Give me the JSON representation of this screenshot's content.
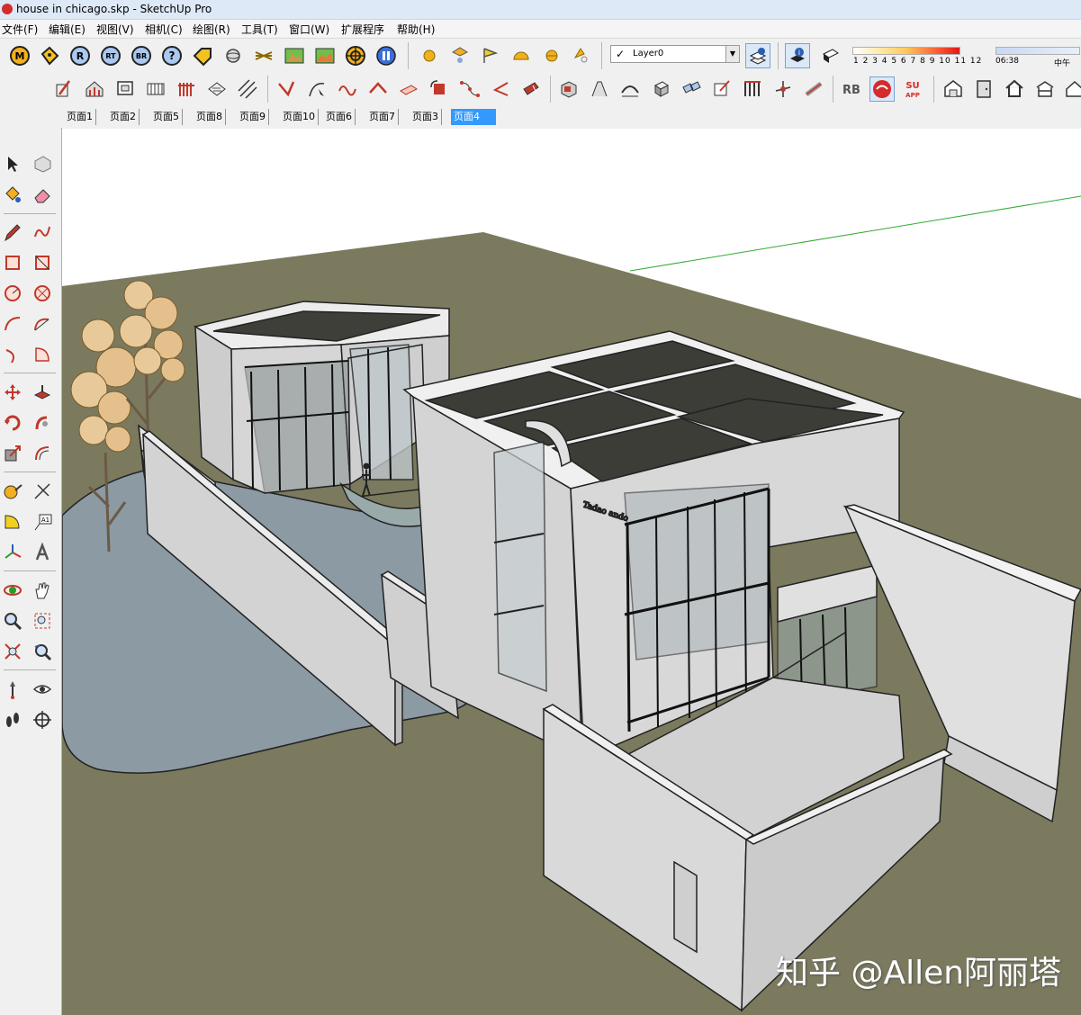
{
  "window": {
    "title": "house in chicago.skp - SketchUp Pro"
  },
  "menu": [
    {
      "id": "file",
      "label": "文件(F)"
    },
    {
      "id": "edit",
      "label": "编辑(E)"
    },
    {
      "id": "view",
      "label": "视图(V)"
    },
    {
      "id": "camera",
      "label": "相机(C)"
    },
    {
      "id": "draw",
      "label": "绘图(R)"
    },
    {
      "id": "tools",
      "label": "工具(T)"
    },
    {
      "id": "window",
      "label": "窗口(W)"
    },
    {
      "id": "extensions",
      "label": "扩展程序"
    },
    {
      "id": "help",
      "label": "帮助(H)"
    }
  ],
  "toolbar1": {
    "plugin_buttons": [
      {
        "icon": "m-plugin-icon",
        "text": "M"
      },
      {
        "icon": "tag-plugin-icon",
        "text": ""
      },
      {
        "icon": "r-plugin-icon",
        "text": "R"
      },
      {
        "icon": "rt-plugin-icon",
        "text": "RT"
      },
      {
        "icon": "br-plugin-icon",
        "text": "BR"
      },
      {
        "icon": "help-plugin-icon",
        "text": "?"
      }
    ],
    "layer": {
      "checked": true,
      "value": "Layer0"
    },
    "shadow": {
      "months": "1 2 3 4 5 6 7 8 9 10 11 12",
      "time": "06:38",
      "noon": "中午"
    }
  },
  "scene_tabs": [
    {
      "label": "页面1",
      "active": false
    },
    {
      "label": "页面2",
      "active": false
    },
    {
      "label": "页面5",
      "active": false
    },
    {
      "label": "页面8",
      "active": false
    },
    {
      "label": "页面9",
      "active": false
    },
    {
      "label": "页面10",
      "active": false
    },
    {
      "label": "页面6",
      "active": false
    },
    {
      "label": "页面7",
      "active": false
    },
    {
      "label": "页面3",
      "active": false
    },
    {
      "label": "页面4",
      "active": true
    }
  ],
  "viewport": {
    "watermark": "知乎 @Allen阿丽塔",
    "colors": {
      "ground": "#7b7a5e",
      "water": "#8c9aa4",
      "concrete": "#d8d8d8",
      "sky": "#ffffff",
      "axis_green": "#33aa33"
    }
  },
  "colors": {
    "accent": "#3399ff",
    "chrome": "#f0f0f0",
    "title_bar": "#dde9f7"
  }
}
